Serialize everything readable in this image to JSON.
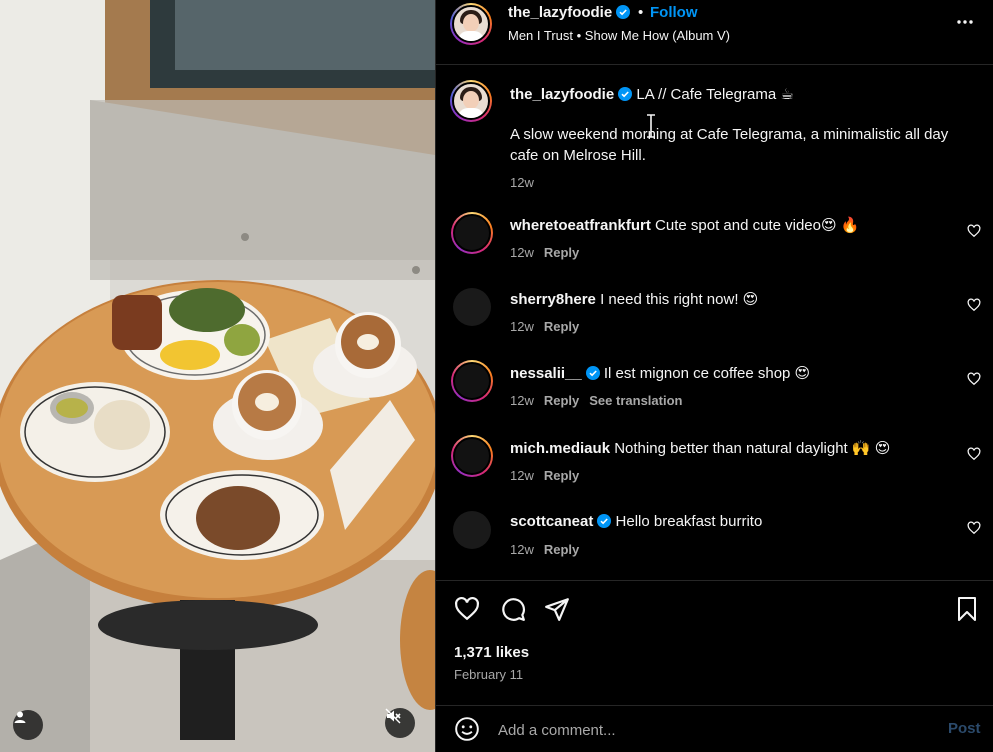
{
  "post": {
    "username": "the_lazyfoodie",
    "follow_label": "Follow",
    "separator": "•",
    "audio": "Men I Trust • Show Me How (Album V)",
    "caption_location": "LA // Cafe Telegrama ☕",
    "caption_text": "A slow weekend morning at Cafe Telegrama, a minimalistic all day cafe on Melrose Hill.",
    "caption_age": "12w"
  },
  "comments": [
    {
      "user": "wheretoeatfrankfurt",
      "text": "Cute spot and cute video😍 🔥",
      "age": "12w",
      "reply": "Reply",
      "verified": false,
      "ring": true
    },
    {
      "user": "sherry8here",
      "text": "I need this right now! 😍",
      "age": "12w",
      "reply": "Reply",
      "verified": false,
      "ring": false
    },
    {
      "user": "nessalii__",
      "text": "Il est mignon ce coffee shop 😍",
      "age": "12w",
      "reply": "Reply",
      "translate": "See translation",
      "verified": true,
      "ring": true
    },
    {
      "user": "mich.mediauk",
      "text": "Nothing better than natural daylight 🙌 😍",
      "age": "12w",
      "reply": "Reply",
      "verified": false,
      "ring": true
    },
    {
      "user": "scottcaneat",
      "text": "Hello breakfast burrito",
      "age": "12w",
      "reply": "Reply",
      "verified": true,
      "ring": false
    }
  ],
  "stats": {
    "likes": "1,371 likes",
    "date": "February 11"
  },
  "composer": {
    "placeholder": "Add a comment...",
    "post_label": "Post"
  },
  "colors": {
    "accent": "#0095f6",
    "background": "#000000",
    "muted_text": "#a8a8a8"
  },
  "icons": [
    "verified-badge-icon",
    "more-options-icon",
    "heart-icon",
    "comment-icon",
    "share-icon",
    "bookmark-icon",
    "emoji-icon",
    "user-tag-icon",
    "muted-icon"
  ]
}
